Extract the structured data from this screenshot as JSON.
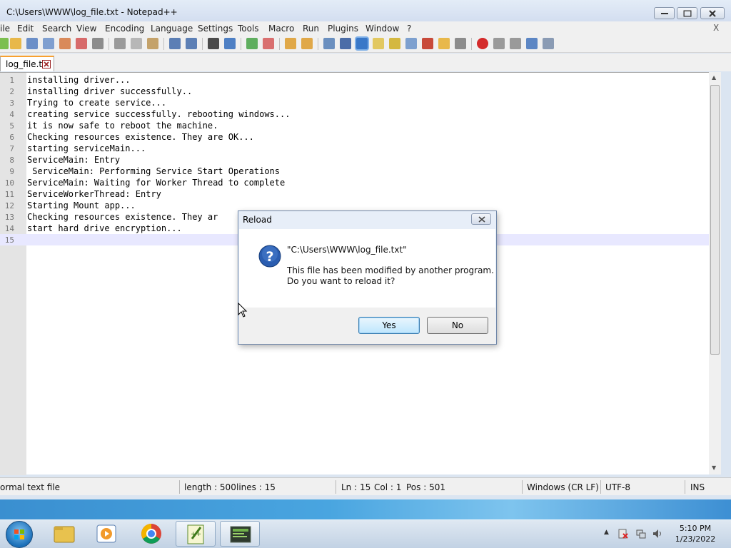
{
  "window": {
    "title": "C:\\Users\\WWW\\log_file.txt - Notepad++"
  },
  "menu": {
    "items": [
      "ile",
      "Edit",
      "Search",
      "View",
      "Encoding",
      "Language",
      "Settings",
      "Tools",
      "Macro",
      "Run",
      "Plugins",
      "Window",
      "?"
    ],
    "close_label": "X"
  },
  "tabs": [
    {
      "label": "log_file.txt"
    }
  ],
  "editor": {
    "lines": [
      {
        "num": "1",
        "text": "installing driver..."
      },
      {
        "num": "2",
        "text": "installing driver successfully.."
      },
      {
        "num": "3",
        "text": "Trying to create service..."
      },
      {
        "num": "4",
        "text": "creating service successfully. rebooting windows..."
      },
      {
        "num": "5",
        "text": "it is now safe to reboot the machine."
      },
      {
        "num": "6",
        "text": "Checking resources existence. They are OK..."
      },
      {
        "num": "7",
        "text": "starting serviceMain..."
      },
      {
        "num": "8",
        "text": "ServiceMain: Entry"
      },
      {
        "num": "9",
        "text": " ServiceMain: Performing Service Start Operations"
      },
      {
        "num": "10",
        "text": "ServiceMain: Waiting for Worker Thread to complete"
      },
      {
        "num": "11",
        "text": "ServiceWorkerThread: Entry"
      },
      {
        "num": "12",
        "text": "Starting Mount app..."
      },
      {
        "num": "13",
        "text": "Checking resources existence. They ar"
      },
      {
        "num": "14",
        "text": "start hard drive encryption..."
      },
      {
        "num": "15",
        "text": ""
      }
    ]
  },
  "statusbar": {
    "filetype": "ormal text file",
    "length": "length : 500",
    "lines": "lines : 15",
    "ln": "Ln : 15",
    "col": "Col : 1",
    "pos": "Pos : 501",
    "eol": "Windows (CR LF)",
    "encoding": "UTF-8",
    "mode": "INS"
  },
  "dialog": {
    "title": "Reload",
    "path": "\"C:\\Users\\WWW\\log_file.txt\"",
    "message_line1": "This file has been modified by another program.",
    "message_line2": "Do you want to reload it?",
    "yes_label": "Yes",
    "no_label": "No"
  },
  "taskbar": {
    "time": "5:10 PM",
    "date": "1/23/2022"
  },
  "colors": {
    "tab_accent": "#f8a030",
    "current_line": "#e8e8ff",
    "dialog_icon": "#2a5db0"
  }
}
